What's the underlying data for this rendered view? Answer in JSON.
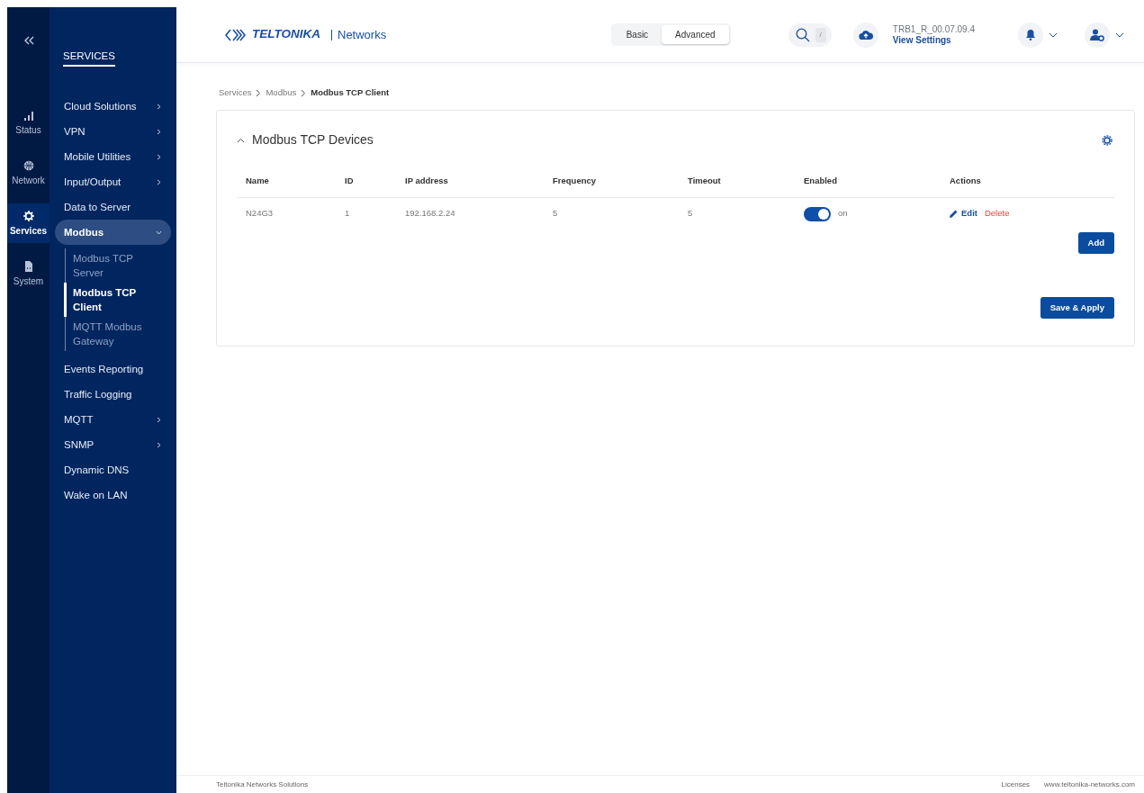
{
  "rail": {
    "items": [
      {
        "label": "Status",
        "selected": false
      },
      {
        "label": "Network",
        "selected": false
      },
      {
        "label": "Services",
        "selected": true
      },
      {
        "label": "System",
        "selected": false
      }
    ]
  },
  "nav": {
    "title": "SERVICES",
    "items": [
      {
        "label": "Cloud Solutions",
        "submenu": true,
        "selected": false
      },
      {
        "label": "VPN",
        "submenu": true,
        "selected": false
      },
      {
        "label": "Mobile Utilities",
        "submenu": true,
        "selected": false
      },
      {
        "label": "Input/Output",
        "submenu": true,
        "selected": false
      },
      {
        "label": "Data to Server",
        "submenu": false,
        "selected": false
      },
      {
        "label": "Modbus",
        "submenu": true,
        "selected": true,
        "expanded": true,
        "children": [
          {
            "label": "Modbus TCP Server",
            "selected": false
          },
          {
            "label": "Modbus TCP Client",
            "selected": true
          },
          {
            "label": "MQTT Modbus Gateway",
            "selected": false
          }
        ]
      },
      {
        "label": "Events Reporting",
        "submenu": false,
        "selected": false
      },
      {
        "label": "Traffic Logging",
        "submenu": false,
        "selected": false
      },
      {
        "label": "MQTT",
        "submenu": true,
        "selected": false
      },
      {
        "label": "SNMP",
        "submenu": true,
        "selected": false
      },
      {
        "label": "Dynamic DNS",
        "submenu": false,
        "selected": false
      },
      {
        "label": "Wake on LAN",
        "submenu": false,
        "selected": false
      }
    ]
  },
  "header": {
    "logo": {
      "brand": "TELTONIKA",
      "product": "Networks"
    },
    "modes": [
      {
        "label": "Basic",
        "selected": false
      },
      {
        "label": "Advanced",
        "selected": true
      }
    ],
    "search_shortcut": "/",
    "firmware": "TRB1_R_00.07.09.4",
    "settings_link": "View Settings"
  },
  "breadcrumb": [
    "Services",
    "Modbus",
    "Modbus TCP Client"
  ],
  "section": {
    "title": "Modbus TCP Devices",
    "expanded": true,
    "table": {
      "columns": [
        "Name",
        "ID",
        "IP address",
        "Frequency",
        "Timeout",
        "Enabled",
        "Actions"
      ],
      "rows": [
        {
          "name": "N24G3",
          "id": "1",
          "ip": "192.168.2.24",
          "frequency": "5",
          "timeout": "5",
          "enabled": true,
          "enabled_label": "on",
          "edit": "Edit",
          "delete": "Delete"
        }
      ]
    },
    "add_button": "Add"
  },
  "save_button": "Save & Apply",
  "footer": {
    "left": "Teltonika Networks Solutions",
    "links": [
      "Licenses",
      "www.teltonika-networks.com"
    ]
  }
}
